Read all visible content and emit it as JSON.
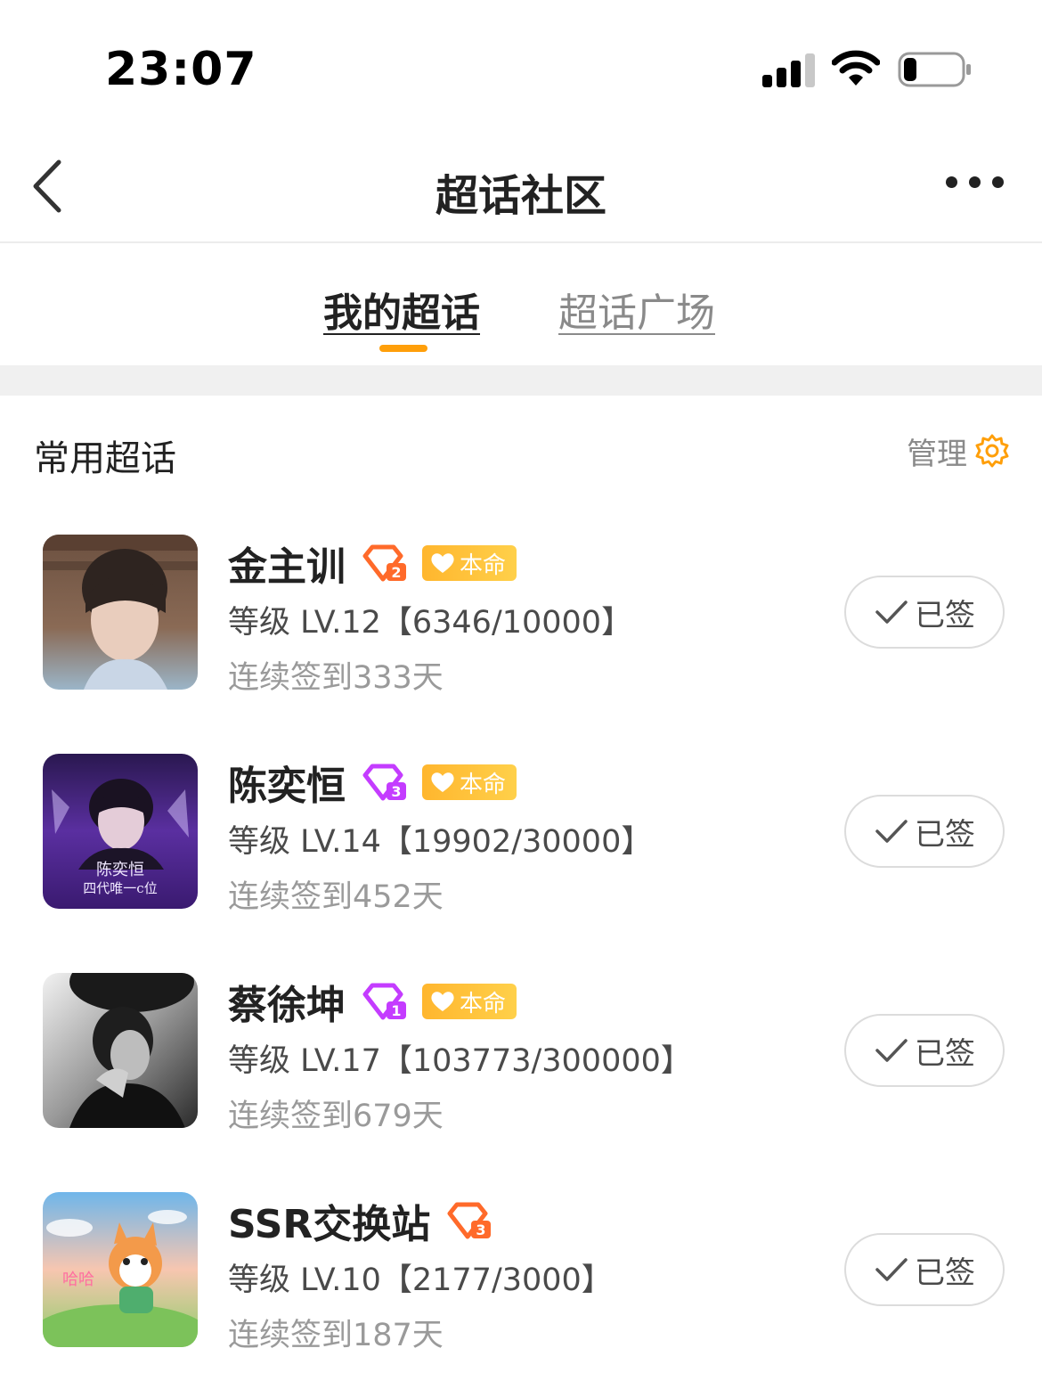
{
  "status_bar": {
    "time": "23:07"
  },
  "nav": {
    "title": "超话社区"
  },
  "tabs": [
    {
      "label": "我的超话",
      "active": true
    },
    {
      "label": "超话广场",
      "active": false
    }
  ],
  "section": {
    "title": "常用超话",
    "manage_label": "管理"
  },
  "items": [
    {
      "name": "金主训",
      "gem_color": "orange",
      "gem_number": "2",
      "show_benming": true,
      "benming_label": "本命",
      "level": "等级 LV.12【6346/10000】",
      "streak": "连续签到333天",
      "button": "已签"
    },
    {
      "name": "陈奕恒",
      "gem_color": "purple",
      "gem_number": "3",
      "show_benming": true,
      "benming_label": "本命",
      "level": "等级 LV.14【19902/30000】",
      "streak": "连续签到452天",
      "button": "已签",
      "avatar_text": [
        "陈奕恒",
        "四代唯一c位"
      ]
    },
    {
      "name": "蔡徐坤",
      "gem_color": "purple",
      "gem_number": "1",
      "show_benming": true,
      "benming_label": "本命",
      "level": "等级 LV.17【103773/300000】",
      "streak": "连续签到679天",
      "button": "已签"
    },
    {
      "name": "SSR交换站",
      "gem_color": "orange",
      "gem_number": "3",
      "show_benming": false,
      "level": "等级 LV.10【2177/3000】",
      "streak": "连续签到187天",
      "button": "已签",
      "avatar_text": [
        "哈哈"
      ]
    }
  ],
  "colors": {
    "accent": "#ff9f0a",
    "gem_orange": "#ff6a2a",
    "gem_purple": "#c43cff"
  }
}
